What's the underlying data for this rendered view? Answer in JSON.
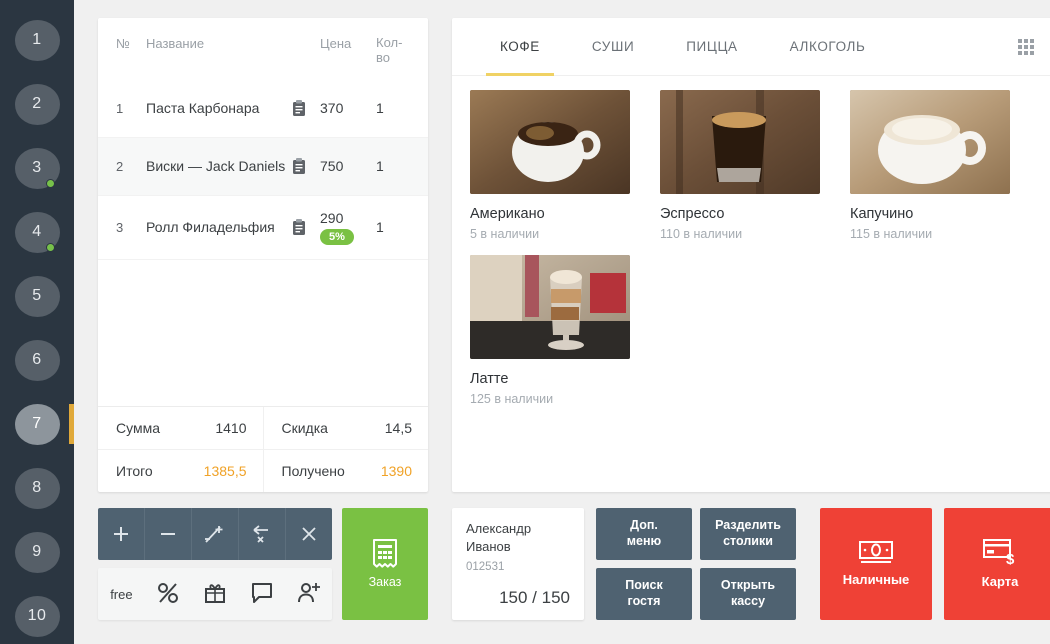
{
  "sidebar": {
    "tables": [
      {
        "label": "1",
        "active": false,
        "dot": false
      },
      {
        "label": "2",
        "active": false,
        "dot": false
      },
      {
        "label": "3",
        "active": false,
        "dot": true
      },
      {
        "label": "4",
        "active": false,
        "dot": true
      },
      {
        "label": "5",
        "active": false,
        "dot": false
      },
      {
        "label": "6",
        "active": false,
        "dot": false
      },
      {
        "label": "7",
        "active": true,
        "dot": false
      },
      {
        "label": "8",
        "active": false,
        "dot": false
      },
      {
        "label": "9",
        "active": false,
        "dot": false
      },
      {
        "label": "10",
        "active": false,
        "dot": false
      }
    ]
  },
  "order": {
    "headers": {
      "num": "№",
      "name": "Название",
      "price": "Цена",
      "qty": "Кол-\nво",
      "qty_line1": "Кол-",
      "qty_line2": "во"
    },
    "rows": [
      {
        "num": "1",
        "name": "Паста Карбонара",
        "price": "370",
        "qty": "1",
        "badge": "",
        "icon": "clipboard-icon"
      },
      {
        "num": "2",
        "name": "Виски — Jack Daniels",
        "price": "750",
        "qty": "1",
        "badge": "",
        "icon": "clipboard-icon"
      },
      {
        "num": "3",
        "name": "Ролл Филадельфия",
        "price": "290",
        "qty": "1",
        "badge": "5%",
        "icon": "clipboard-icon"
      }
    ],
    "totals": {
      "sum_label": "Сумма",
      "sum_value": "1410",
      "discount_label": "Скидка",
      "discount_value": "14,5",
      "total_label": "Итого",
      "total_value": "1385,5",
      "received_label": "Получено",
      "received_value": "1390"
    }
  },
  "toolbar": {
    "top": [
      {
        "name": "add-item-button",
        "glyph": "+"
      },
      {
        "name": "remove-item-button",
        "glyph": "−"
      },
      {
        "name": "split-item-button",
        "glyph": "split"
      },
      {
        "name": "move-item-button",
        "glyph": "move"
      },
      {
        "name": "delete-item-button",
        "glyph": "×"
      }
    ],
    "bottom": [
      {
        "name": "free-button",
        "label": "free"
      },
      {
        "name": "percent-discount-button",
        "label": "%"
      },
      {
        "name": "gift-button",
        "label": "gift"
      },
      {
        "name": "comment-button",
        "label": "comment"
      },
      {
        "name": "add-guest-button",
        "label": "add-guest"
      }
    ],
    "order_button": "Заказ"
  },
  "catalog": {
    "tabs": [
      {
        "label": "КОФЕ",
        "active": true
      },
      {
        "label": "СУШИ",
        "active": false
      },
      {
        "label": "ПИЦЦА",
        "active": false
      },
      {
        "label": "АЛКОГОЛЬ",
        "active": false
      }
    ],
    "view_toggle": "grid-view-icon",
    "products": [
      {
        "name": "Американо",
        "stock": "5 в наличии",
        "image": "americano-coffee-cup"
      },
      {
        "name": "Эспрессо",
        "stock": "110 в наличии",
        "image": "espresso-glass"
      },
      {
        "name": "Капучино",
        "stock": "115 в наличии",
        "image": "cappuccino-cup"
      },
      {
        "name": "Латте",
        "stock": "125 в наличии",
        "image": "latte-glass"
      }
    ]
  },
  "guest": {
    "name_line1": "Александр",
    "name_line2": "Иванов",
    "id": "012531",
    "points": "150 / 150"
  },
  "actions": [
    {
      "name": "extra-menu-button",
      "line1": "Доп.",
      "line2": "меню"
    },
    {
      "name": "split-tables-button",
      "line1": "Разделить",
      "line2": "столики"
    },
    {
      "name": "search-guest-button",
      "line1": "Поиск",
      "line2": "гостя"
    },
    {
      "name": "open-register-button",
      "line1": "Открыть",
      "line2": "кассу"
    }
  ],
  "payments": [
    {
      "name": "cash-payment-button",
      "label": "Наличные",
      "icon": "cash-icon"
    },
    {
      "name": "card-payment-button",
      "label": "Карта",
      "icon": "credit-card-icon"
    }
  ],
  "colors": {
    "sidebar_bg": "#2b3641",
    "accent_gold": "#e0a93a",
    "tab_underline": "#f0d264",
    "green": "#7ac143",
    "red": "#ef4136",
    "slate": "#4f6271",
    "amber_text": "#f0a227"
  }
}
